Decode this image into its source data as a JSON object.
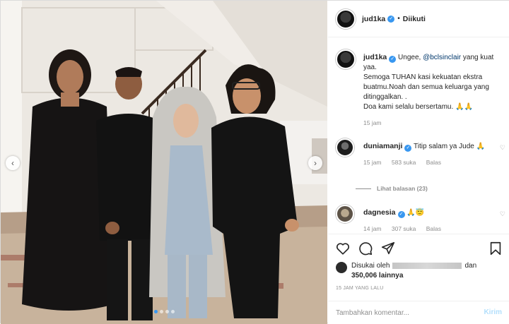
{
  "post": {
    "author": "jud1ka",
    "separator": "•",
    "follow_status": "Diikuti",
    "caption": {
      "author": "jud1ka",
      "text_prefix": "Ungee, ",
      "mention": "@bclsinclair",
      "text_suffix": " yang kuat yaa.",
      "line2": "Semoga TUHAN kasi kekuatan ekstra buatmu.Noah dan semua keluarga yang ditinggalkan. .",
      "line3": "Doa kami selalu bersertamu. 🙏🙏",
      "time": "15 jam"
    },
    "comments": [
      {
        "user": "duniamanji",
        "text": "Titip salam ya Jude 🙏",
        "time": "15 jam",
        "likes": "583 suka",
        "reply": "Balas",
        "view_replies": "Lihat balasan (23)"
      },
      {
        "user": "dagnesia",
        "text": "🙏😇",
        "time": "14 jam",
        "likes": "307 suka",
        "reply": "Balas"
      }
    ],
    "likes": {
      "prefix": "Disukai oleh",
      "connector": "dan",
      "count": "350,006 lainnya"
    },
    "timestamp": "15 JAM YANG LALU",
    "add_comment": {
      "placeholder": "Tambahkan komentar...",
      "send_label": "Kirim"
    },
    "carousel": {
      "prev": "‹",
      "next": "›",
      "dots": 4,
      "active": 0
    },
    "colors": {
      "accent": "#3897f0",
      "mention": "#00376b",
      "muted": "#8e8e8e",
      "send_disabled": "#b2dffc"
    },
    "icons": [
      "heart-icon",
      "comment-icon",
      "share-icon",
      "bookmark-icon",
      "verified-icon"
    ]
  }
}
